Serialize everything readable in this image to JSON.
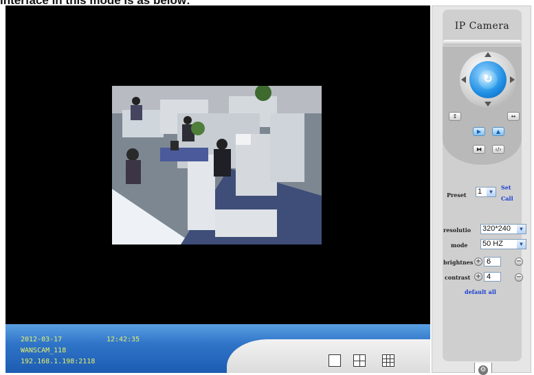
{
  "caption": "interface in this mode is as below:",
  "panel": {
    "title": "IP Camera"
  },
  "ptz": {
    "center_glyph": "↻",
    "vertical_patrol_glyph": "↕",
    "horizontal_patrol_glyph": "↔",
    "blue_left_glyph": "▶",
    "blue_right_glyph": "▲",
    "grey_left_glyph": "⧓",
    "grey_right_glyph": "‹/›"
  },
  "preset": {
    "label": "Preset",
    "value": "1",
    "set_label": "Set",
    "call_label": "Call"
  },
  "resolution": {
    "label": "resolutio",
    "value": "320*240"
  },
  "mode": {
    "label": "mode",
    "value": "50 HZ"
  },
  "brightness": {
    "label": "brightnes",
    "value": "6"
  },
  "contrast": {
    "label": "contrast",
    "value": "4"
  },
  "default_all": "default all",
  "status": {
    "date": "2012-03-17",
    "time": "12:42:35",
    "camera_name": "WANSCAM_118",
    "address": "192.168.1.198:2118"
  },
  "controls": {
    "plus": "+",
    "minus": "−",
    "dropdown": "▼",
    "gear": "⚙"
  },
  "colors": {
    "status_text": "#e9f06a",
    "status_bar": "#2f74c8",
    "link": "#1a3fd0"
  }
}
